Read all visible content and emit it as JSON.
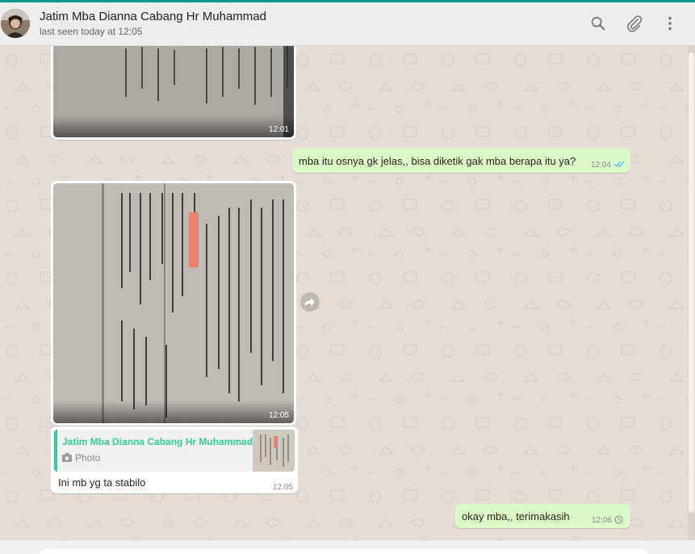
{
  "header": {
    "contact_name": "Jatim Mba Dianna Cabang Hr Muhammad",
    "status": "last seen today at 12:05",
    "icons": [
      "search-icon",
      "attach-icon",
      "menu-icon"
    ]
  },
  "colors": {
    "accent": "#009688",
    "header_bg": "#ededed",
    "chat_bg": "#e5ddd5",
    "incoming_bubble": "#ffffff",
    "outgoing_bubble": "#dcf8c6",
    "quote_accent": "#35cd96",
    "read_tick": "#4fc3f7"
  },
  "messages": [
    {
      "direction": "in",
      "kind": "image",
      "time": "12:01"
    },
    {
      "direction": "out",
      "kind": "text",
      "text": "mba itu osnya gk jelas,, bisa diketik gak mba berapa itu ya?",
      "time": "12:04",
      "status": "read"
    },
    {
      "direction": "in",
      "kind": "image",
      "time": "12:05"
    },
    {
      "direction": "in",
      "kind": "reply",
      "text": "Ini mb yg ta stabilo",
      "time": "12:05",
      "quote": {
        "author": "Jatim Mba Dianna Cabang Hr Muhammad",
        "type": "Photo",
        "type_icon": "camera-icon"
      }
    },
    {
      "direction": "out",
      "kind": "text",
      "text": "okay mba,, terimakasih",
      "time": "12:06",
      "status": "pending"
    }
  ]
}
